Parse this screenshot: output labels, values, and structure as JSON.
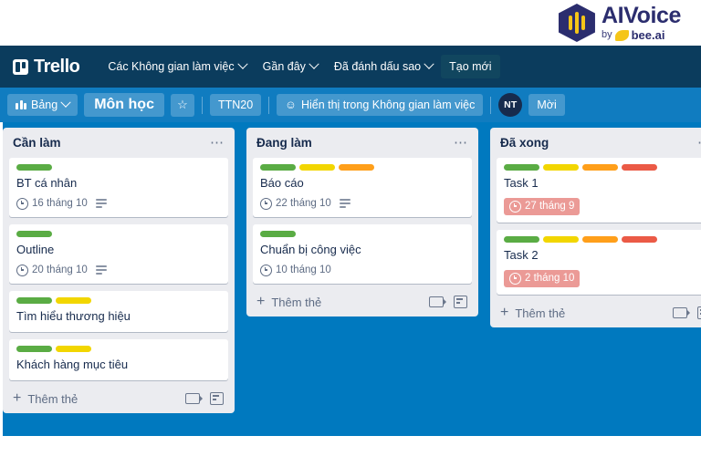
{
  "brand": {
    "title": "AIVoice",
    "by": "by",
    "bee": "bee.ai",
    "hex_color": "#2b2d6e",
    "bar_color": "#f5c518"
  },
  "topnav": {
    "logo_text": "Trello",
    "items": [
      {
        "label": "Các Không gian làm việc",
        "has_chevron": true,
        "boxed": false
      },
      {
        "label": "Gần đây",
        "has_chevron": true,
        "boxed": false
      },
      {
        "label": "Đã đánh dấu sao",
        "has_chevron": true,
        "boxed": false
      },
      {
        "label": "Tạo mới",
        "has_chevron": false,
        "boxed": true
      }
    ],
    "background": "#0b3c5d"
  },
  "boardbar": {
    "view_label": "Bảng",
    "board_title": "Môn học",
    "star_icon": "☆",
    "workspace_label": "TTN20",
    "visibility_label": "Hiển thị trong Không gian làm việc",
    "avatar_initials": "NT",
    "invite_label": "Mời",
    "background": "#107cc0"
  },
  "board": {
    "background": "#0079bf",
    "add_card_label": "Thêm thẻ",
    "lists": [
      {
        "title": "Cần làm",
        "cards": [
          {
            "title": "BT cá nhân",
            "labels": [
              "#5aac44"
            ],
            "date": "16 tháng 10",
            "overdue": false,
            "has_description": true
          },
          {
            "title": "Outline",
            "labels": [
              "#5aac44"
            ],
            "date": "20 tháng 10",
            "overdue": false,
            "has_description": true
          },
          {
            "title": "Tìm hiểu thương hiệu",
            "labels": [
              "#5aac44",
              "#f2d600"
            ],
            "date": "",
            "overdue": false,
            "has_description": false
          },
          {
            "title": "Khách hàng mục tiêu",
            "labels": [
              "#5aac44",
              "#f2d600"
            ],
            "date": "",
            "overdue": false,
            "has_description": false
          }
        ]
      },
      {
        "title": "Đang làm",
        "cards": [
          {
            "title": "Báo cáo",
            "labels": [
              "#5aac44",
              "#f2d600",
              "#ff9f1a"
            ],
            "date": "22 tháng 10",
            "overdue": false,
            "has_description": true
          },
          {
            "title": "Chuẩn bị công việc",
            "labels": [
              "#5aac44"
            ],
            "date": "10 tháng 10",
            "overdue": false,
            "has_description": false
          }
        ]
      },
      {
        "title": "Đã xong",
        "cards": [
          {
            "title": "Task 1",
            "labels": [
              "#5aac44",
              "#f2d600",
              "#ff9f1a",
              "#eb5a46"
            ],
            "date": "27 tháng 9",
            "overdue": true,
            "has_description": false
          },
          {
            "title": "Task 2",
            "labels": [
              "#5aac44",
              "#f2d600",
              "#ff9f1a",
              "#eb5a46"
            ],
            "date": "2 tháng 10",
            "overdue": true,
            "has_description": false
          }
        ]
      }
    ]
  }
}
